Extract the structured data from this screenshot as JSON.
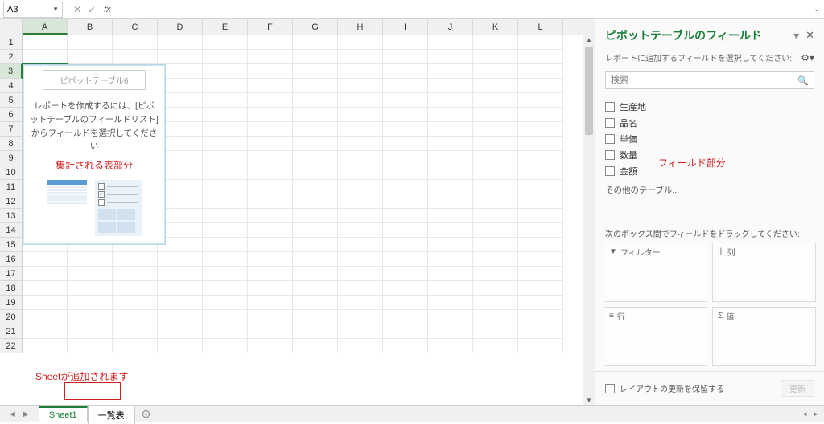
{
  "formula_bar": {
    "name_box": "A3",
    "fx_label": "fx",
    "value": ""
  },
  "columns": [
    "A",
    "B",
    "C",
    "D",
    "E",
    "F",
    "G",
    "H",
    "I",
    "J",
    "K",
    "L"
  ],
  "rows": [
    "1",
    "2",
    "3",
    "4",
    "5",
    "6",
    "7",
    "8",
    "9",
    "10",
    "11",
    "12",
    "13",
    "14",
    "15",
    "16",
    "17",
    "18",
    "19",
    "20",
    "21",
    "22"
  ],
  "active_cell": "A3",
  "placeholder": {
    "title": "ピボットテーブル6",
    "text": "レポートを作成するには、[ピボットテーブルのフィールドリスト] からフィールドを選択してください"
  },
  "annotation": {
    "summary_area": "集計される表部分",
    "sheet_added": "Sheetが追加されます",
    "field_area": "フィールド部分"
  },
  "panel": {
    "title": "ピボットテーブルのフィールド",
    "subtitle": "レポートに追加するフィールドを選択してください:",
    "search_placeholder": "検索",
    "fields": [
      "生産地",
      "品名",
      "単価",
      "数量",
      "金額"
    ],
    "other_tables": "その他のテーブル...",
    "drag_label": "次のボックス間でフィールドをドラッグしてください:",
    "box_filter": "フィルター",
    "box_columns": "列",
    "box_rows": "行",
    "box_values": "値",
    "defer_label": "レイアウトの更新を保留する",
    "update_btn": "更新"
  },
  "tabs": {
    "sheet1": "Sheet1",
    "list": "一覧表"
  }
}
